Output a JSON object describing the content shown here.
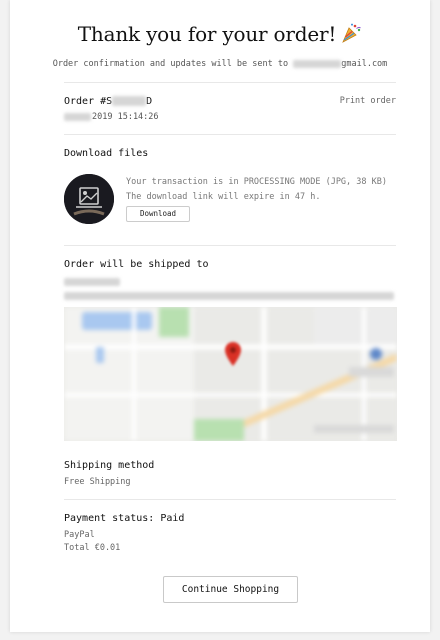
{
  "header": {
    "title": "Thank you for your order!",
    "subtitle_prefix": "Order confirmation and updates will be sent to ",
    "subtitle_suffix": "gmail.com"
  },
  "order": {
    "number_prefix": "Order #S",
    "number_suffix": "D",
    "print_label": "Print order",
    "date_time": "2019 15:14:26"
  },
  "download": {
    "title": "Download files",
    "line1": "Your transaction is in PROCESSING MODE (JPG, 38 KB)",
    "line2": "The download link will expire in 47 h.",
    "button_label": "Download"
  },
  "shipping_address": {
    "title": "Order will be shipped to"
  },
  "shipping_method": {
    "title": "Shipping method",
    "value": "Free Shipping"
  },
  "payment": {
    "title": "Payment status: Paid",
    "method": "PayPal",
    "total": "Total €0.01"
  },
  "footer": {
    "continue_label": "Continue Shopping"
  },
  "icons": {
    "party": "party-popper-icon",
    "thumbnail": "image-thumbnail-icon",
    "map_pin": "map-pin-icon"
  },
  "colors": {
    "map_pin": "#d93025",
    "map_road": "#f5d9a8",
    "map_park": "#b8e0b0",
    "map_water": "#a9c8f0"
  }
}
